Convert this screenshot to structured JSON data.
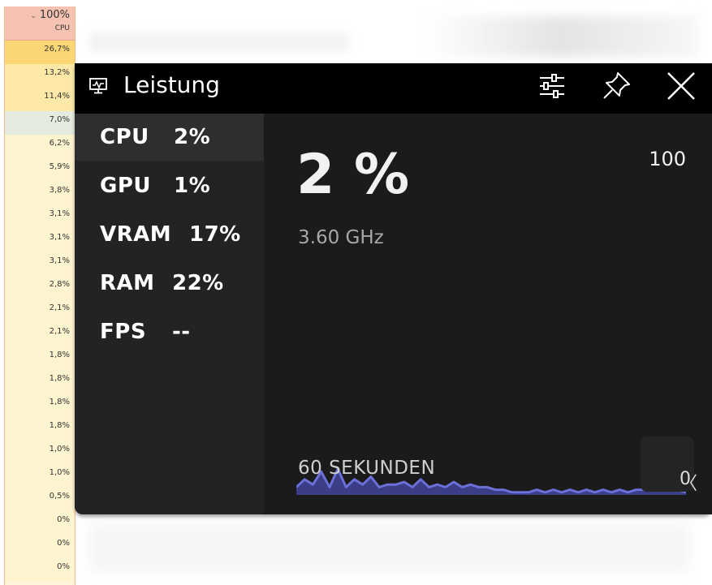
{
  "task_manager": {
    "header_percent": "100%",
    "header_label": "CPU",
    "rows": [
      {
        "value": "26,7%",
        "color": "#fbd675"
      },
      {
        "value": "13,2%",
        "color": "#fde8a8"
      },
      {
        "value": "11,4%",
        "color": "#fde8a8"
      },
      {
        "value": "7,0%",
        "color": "#e6ebdf"
      },
      {
        "value": "6,2%",
        "color": "#fff4d0"
      },
      {
        "value": "5,9%",
        "color": "#fff4d0"
      },
      {
        "value": "3,8%",
        "color": "#fff4d0"
      },
      {
        "value": "3,1%",
        "color": "#fff4d0"
      },
      {
        "value": "3,1%",
        "color": "#fff4d0"
      },
      {
        "value": "3,1%",
        "color": "#fff4d0"
      },
      {
        "value": "2,8%",
        "color": "#fff4d0"
      },
      {
        "value": "2,1%",
        "color": "#fff4d0"
      },
      {
        "value": "2,1%",
        "color": "#fff4d0"
      },
      {
        "value": "1,8%",
        "color": "#fff4d0"
      },
      {
        "value": "1,8%",
        "color": "#fff4d0"
      },
      {
        "value": "1,8%",
        "color": "#fff4d0"
      },
      {
        "value": "1,8%",
        "color": "#fff4d0"
      },
      {
        "value": "1,0%",
        "color": "#fff4d0"
      },
      {
        "value": "1,0%",
        "color": "#fff4d0"
      },
      {
        "value": "0,5%",
        "color": "#fff4d0"
      },
      {
        "value": "0%",
        "color": "#fff4d0"
      },
      {
        "value": "0%",
        "color": "#fff4d0"
      },
      {
        "value": "0%",
        "color": "#fff4d0"
      }
    ]
  },
  "widget": {
    "title": "Leistung",
    "title_icon": "monitor-icon",
    "buttons": {
      "settings_icon": "sliders-icon",
      "pin_icon": "pin-icon",
      "close_icon": "close-icon"
    },
    "metrics": [
      {
        "name": "CPU",
        "value": "2%",
        "active": true
      },
      {
        "name": "GPU",
        "value": "1%",
        "active": false
      },
      {
        "name": "VRAM",
        "value": "17%",
        "active": false
      },
      {
        "name": "RAM",
        "value": "22%",
        "active": false
      },
      {
        "name": "FPS",
        "value": "--",
        "active": false
      }
    ],
    "detail": {
      "current_value": "2 %",
      "max_value": "100",
      "frequency": "3.60 GHz",
      "time_span": "60 SEKUNDEN",
      "corner_button_label": "0",
      "corner_button_icon": "chevron-left-icon"
    },
    "accent_color": "#6b6fd8"
  },
  "chart_data": {
    "type": "area",
    "title": "",
    "xlabel": "60 SEKUNDEN",
    "ylabel": "",
    "ylim": [
      0,
      100
    ],
    "series": [
      {
        "values": [
          3,
          6,
          4,
          9,
          3,
          10,
          3,
          6,
          4,
          7,
          3,
          4,
          4,
          5,
          3,
          6,
          3,
          4,
          3,
          5,
          3,
          4,
          3,
          3,
          2,
          2,
          1,
          1,
          1,
          2,
          1,
          2,
          1,
          2,
          1,
          2,
          1,
          2,
          1,
          2,
          1,
          2,
          2,
          3,
          3,
          2,
          2,
          1
        ]
      }
    ]
  }
}
